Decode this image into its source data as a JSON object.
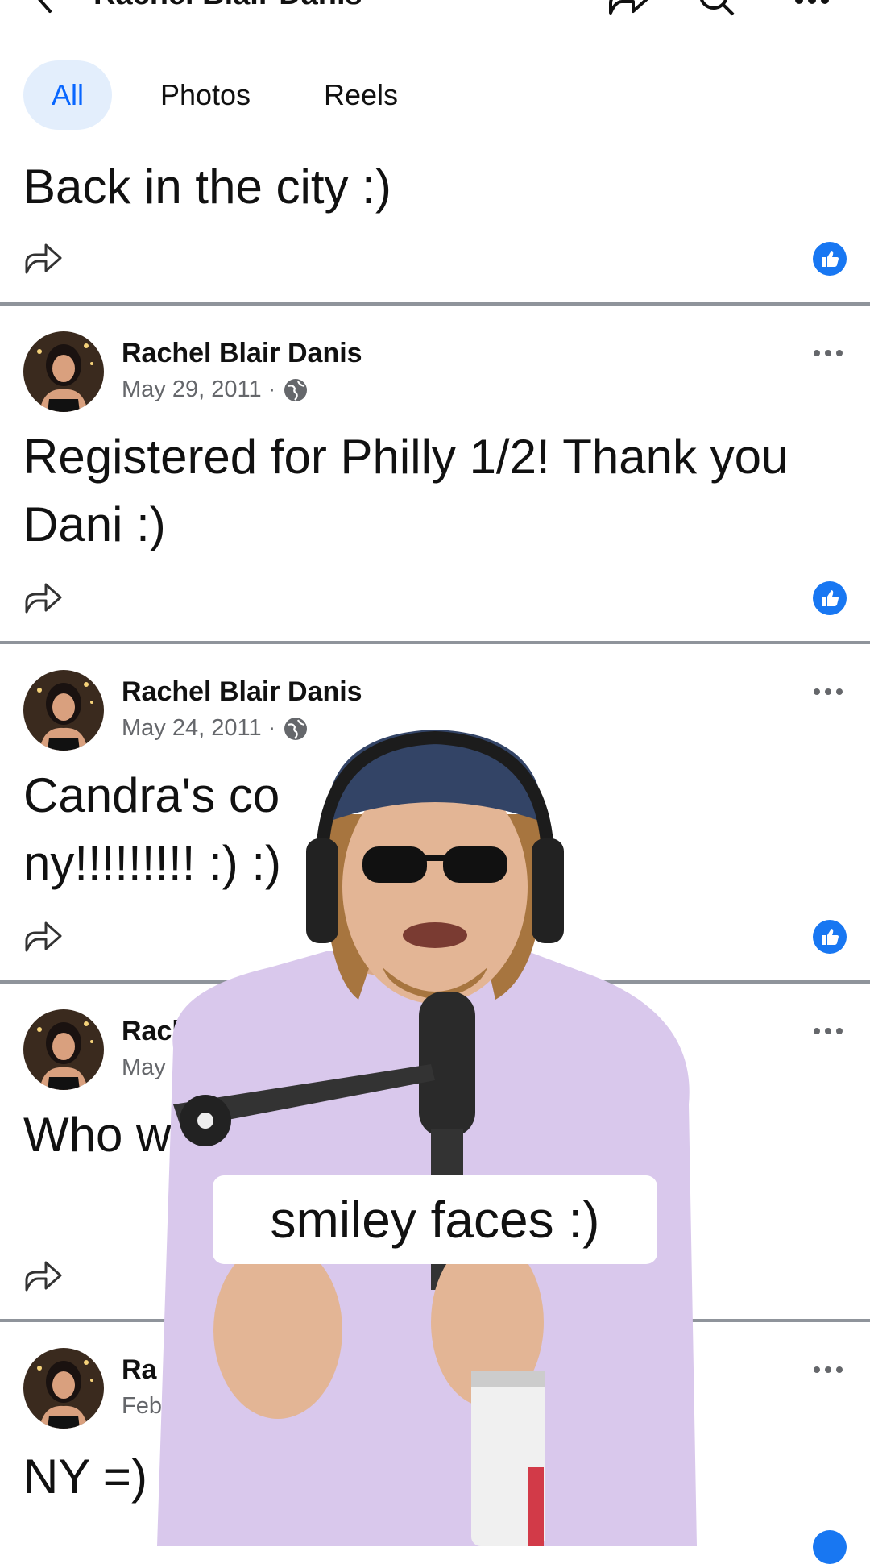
{
  "header": {
    "title": "Rachel Blair Danis",
    "icons": [
      "back-icon",
      "share-icon",
      "search-icon",
      "more-icon"
    ]
  },
  "tabs": [
    {
      "label": "All",
      "active": true
    },
    {
      "label": "Photos",
      "active": false
    },
    {
      "label": "Reels",
      "active": false
    }
  ],
  "posts": [
    {
      "text": "Back in the city :)"
    },
    {
      "author": "Rachel Blair Danis",
      "date": "May 29, 2011 ·",
      "text": "Registered for Philly 1/2!  Thank you Dani :)"
    },
    {
      "author": "Rachel Blair Danis",
      "date": "May 24, 2011 ·",
      "text": "Candra's co ny!!!!!!!!! :) :)"
    },
    {
      "author": "Rachel Blai",
      "date": "May 15,",
      "text": "Who w am @ DAC v 30?"
    },
    {
      "author": "Ra",
      "date": "Feb",
      "text": "NY =)"
    }
  ],
  "caption": "smiley faces :)",
  "colors": {
    "accent": "#0866ff",
    "tab_active_bg": "#e3eefc",
    "meta": "#65676b",
    "separator": "#8f949b"
  }
}
